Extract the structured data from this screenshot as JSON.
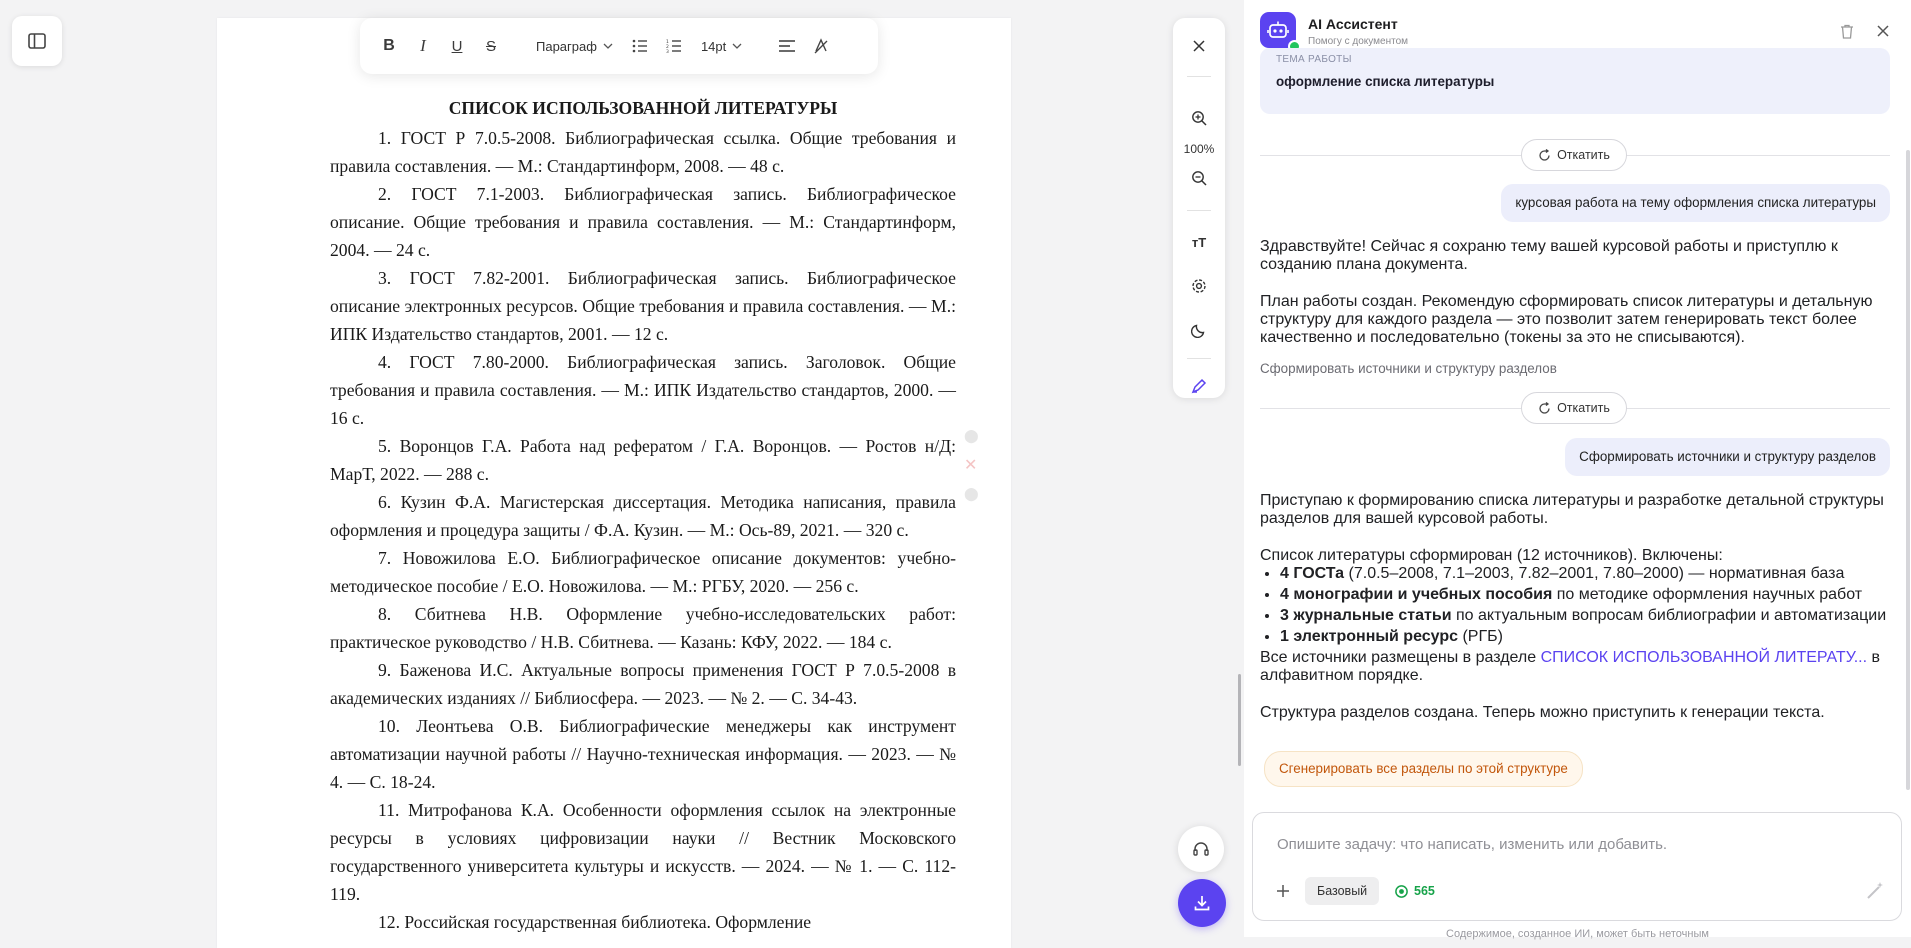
{
  "toolbar": {
    "paragraph_style": "Параграф",
    "font_size": "14pt"
  },
  "document": {
    "heading": "СПИСОК ИСПОЛЬЗОВАННОЙ ЛИТЕРАТУРЫ",
    "items": [
      "1. ГОСТ Р 7.0.5-2008. Библиографическая ссылка. Общие требования и правила составления. — М.: Стандартинформ, 2008. — 48 с.",
      "2. ГОСТ 7.1-2003. Библиографическая запись. Библиографическое описание. Общие требования и правила составления. — М.: Стандартинформ, 2004. — 24 с.",
      "3. ГОСТ 7.82-2001. Библиографическая запись. Библиографическое описание электронных ресурсов. Общие требования и правила составления. — М.: ИПК Издательство стандартов, 2001. — 12 с.",
      "4. ГОСТ 7.80-2000. Библиографическая запись. Заголовок. Общие требования и правила составления. — М.: ИПК Издательство стандартов, 2000. — 16 с.",
      "5. Воронцов Г.А. Работа над рефератом / Г.А. Воронцов. — Ростов н/Д: МарТ, 2022. — 288 с.",
      "6. Кузин Ф.А. Магистерская диссертация. Методика написания, правила оформления и процедура защиты / Ф.А. Кузин. — М.: Ось-89, 2021. — 320 с.",
      "7. Новожилова Е.О. Библиографическое описание документов: учебно-методическое пособие / Е.О. Новожилова. — М.: РГБУ, 2020. — 256 с.",
      "8. Сбитнева Н.В. Оформление учебно-исследовательских работ: практическое руководство / Н.В. Сбитнева. — Казань: КФУ, 2022. — 184 с.",
      "9. Баженова И.С. Актуальные вопросы применения ГОСТ Р 7.0.5-2008 в академических изданиях // Библиосфера. — 2023. — № 2. — С. 34-43.",
      "10. Леонтьева О.В. Библиографические менеджеры как инструмент автоматизации научной работы // Научно-техническая информация. — 2023. — № 4. — С. 18-24.",
      "11. Митрофанова К.А. Особенности оформления ссылок на электронные ресурсы в условиях цифровизации науки // Вестник Московского государственного университета культуры и искусств. — 2024. — № 1. — С. 112-119.",
      "12. Российская государственная библиотека. Оформление"
    ]
  },
  "tools": {
    "zoom": "100%"
  },
  "assistant": {
    "title": "AI Ассистент",
    "subtitle": "Помогу с документом",
    "topic_label": "ТЕМА РАБОТЫ",
    "topic_value": "оформление списка литературы",
    "rollback_label": "Откатить",
    "user_msg_1": "курсовая работа на тему оформления списка литературы",
    "reply_1_p1": "Здравствуйте! Сейчас я сохраню тему вашей курсовой работы и приступлю к созданию плана документа.",
    "reply_1_p2": "План работы создан. Рекомендую сформировать список литературы и детальную структуру для каждого раздела — это позволит затем генерировать текст более качественно и последовательно (токены за это не списываются).",
    "suggestion_1": "Сформировать источники и структуру разделов",
    "user_msg_2": "Сформировать источники и структуру разделов",
    "reply_2_p1": "Приступаю к формированию списка литературы и разработке детальной структуры разделов для вашей курсовой работы.",
    "reply_2_p2": "Список литературы сформирован (12 источников). Включены:",
    "bullets": [
      {
        "bold": "4 ГОСТа",
        "rest": " (7.0.5–2008, 7.1–2003, 7.82–2001, 7.80–2000) — нормативная база"
      },
      {
        "bold": "4 монографии и учебных пособия",
        "rest": " по методике оформления научных работ"
      },
      {
        "bold": "3 журнальные статьи",
        "rest": " по актуальным вопросам библиографии и автоматизации"
      },
      {
        "bold": "1 электронный ресурс",
        "rest": " (РГБ)"
      }
    ],
    "reply_2_p3_before": "Все источники размещены в разделе ",
    "reply_2_p3_link": "СПИСОК ИСПОЛЬЗОВАННОЙ ЛИТЕРАТУ...",
    "reply_2_p3_after": " в алфавитном порядке.",
    "reply_2_p4": "Структура разделов создана. Теперь можно приступить к генерации текста.",
    "action_generate": "Сгенерировать все разделы по этой структуре",
    "input_placeholder": "Опишите задачу: что написать, изменить или добавить.",
    "mode": "Базовый",
    "tokens": "565",
    "disclaimer": "Содержимое, созданное ИИ, может быть неточным"
  },
  "colors": {
    "accent": "#5b43f0",
    "online": "#22c55e",
    "tokens": "#17a34a",
    "action_text": "#c2570c"
  },
  "icons": [
    "sidebar-toggle-icon",
    "bold-icon",
    "italic-icon",
    "underline-icon",
    "strikethrough-icon",
    "chevron-down-icon",
    "bullet-list-icon",
    "numbered-list-icon",
    "align-icon",
    "clear-format-icon",
    "close-icon",
    "zoom-in-icon",
    "zoom-out-icon",
    "font-size-icon",
    "gear-icon",
    "moon-icon",
    "pen-icon",
    "headset-icon",
    "download-icon",
    "robot-icon",
    "trash-icon",
    "refresh-icon",
    "plus-icon",
    "coin-icon",
    "magic-wand-icon"
  ]
}
